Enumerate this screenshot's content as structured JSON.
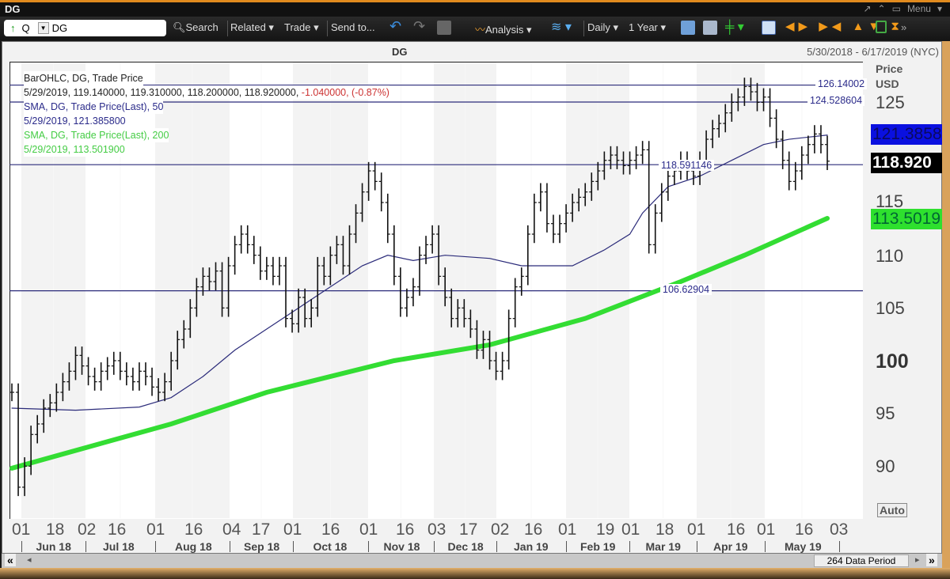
{
  "window": {
    "title": "DG",
    "menu_label": "Menu"
  },
  "toolbar": {
    "ticker_prefix": "Q",
    "ticker": "DG",
    "search": "Search",
    "related": "Related",
    "trade": "Trade",
    "send_to": "Send to...",
    "analysis": "Analysis",
    "period": "Daily",
    "range": "1 Year"
  },
  "chart_data": {
    "type": "bar",
    "title": "DG",
    "date_range": "5/30/2018 - 6/17/2019 (NYC)",
    "ylabel": "Price",
    "ylabel2": "USD",
    "ylim": [
      85.5,
      128
    ],
    "y_ticks": [
      "125",
      "115",
      "110",
      "105",
      "100",
      "95",
      "90"
    ],
    "y_tick_values": [
      125,
      115,
      110,
      105,
      100,
      95,
      90
    ],
    "auto_label": "Auto",
    "legend": {
      "l1": "BarOHLC, DG, Trade Price",
      "l2a": "5/29/2019, 119.140000, 119.310000, 118.200000, 118.920000, ",
      "l2b": "-1.040000, (-0.87%)",
      "l3": "SMA, DG, Trade Price(Last),  50",
      "l4": "5/29/2019, 121.385800",
      "l5": "SMA, DG, Trade Price(Last),  200",
      "l6": "5/29/2019, 113.501900"
    },
    "hlines": [
      {
        "value": 126.14002,
        "label": "126.14002"
      },
      {
        "value": 124.528604,
        "label": "124.528604"
      },
      {
        "value": 118.591146,
        "label": "118.591146"
      },
      {
        "value": 106.62904,
        "label": "106.62904"
      }
    ],
    "tags": {
      "sma50": "121.3858",
      "last": "118.920",
      "sma200": "113.5019"
    },
    "day_ticks": [
      "01",
      "18",
      "02",
      "16",
      "01",
      "16",
      "04",
      "17",
      "01",
      "16",
      "01",
      "16",
      "03",
      "17",
      "02",
      "16",
      "01",
      "19",
      "01",
      "18",
      "01",
      "16",
      "01",
      "16",
      "03"
    ],
    "months": [
      "Jun 18",
      "Jul 18",
      "Aug 18",
      "Sep 18",
      "Oct 18",
      "Nov 18",
      "Dec 18",
      "Jan 19",
      "Feb 19",
      "Mar 19",
      "Apr 19",
      "May 19"
    ],
    "closes": [
      97,
      88,
      90,
      93,
      94,
      95.5,
      96,
      97,
      98,
      99,
      100.5,
      99.5,
      98.5,
      98,
      99,
      99.5,
      100,
      99,
      98.5,
      98,
      99,
      98.5,
      97.5,
      97,
      98,
      100,
      102,
      103,
      105,
      107,
      108,
      107.5,
      108.5,
      105,
      109,
      111,
      112,
      111,
      110,
      108.5,
      109,
      108,
      109,
      104,
      103.5,
      106,
      104,
      105,
      109,
      108,
      110,
      111,
      109,
      112,
      114,
      116,
      118,
      117,
      115,
      112,
      108,
      105,
      106,
      107,
      110,
      111,
      112,
      108,
      106,
      104,
      105,
      104,
      103,
      101,
      102,
      100,
      99,
      100,
      104,
      107,
      108,
      112,
      115,
      116,
      113,
      112,
      113,
      114,
      115,
      115.5,
      116,
      117,
      118,
      119,
      119.5,
      119,
      118.5,
      119,
      119.5,
      120,
      111,
      114,
      116,
      117.5,
      118,
      119,
      118,
      117.5,
      119,
      121,
      122,
      122.5,
      123.5,
      124.5,
      125,
      126,
      125.5,
      124.5,
      125,
      123,
      121,
      119,
      117,
      118,
      119.5,
      120.5,
      121.5,
      120.5,
      118.92
    ],
    "bar_range": 1.4,
    "sma50": [
      [
        0,
        95.5
      ],
      [
        10,
        95.3
      ],
      [
        20,
        95.6
      ],
      [
        25,
        96.5
      ],
      [
        30,
        98.5
      ],
      [
        35,
        101
      ],
      [
        40,
        103
      ],
      [
        45,
        105
      ],
      [
        50,
        107
      ],
      [
        55,
        109
      ],
      [
        59,
        110
      ],
      [
        63,
        109.5
      ],
      [
        68,
        110
      ],
      [
        75,
        109.7
      ],
      [
        80,
        109
      ],
      [
        88,
        109
      ],
      [
        93,
        110.5
      ],
      [
        97,
        112
      ],
      [
        99,
        114
      ],
      [
        103,
        116.5
      ],
      [
        108,
        117.5
      ],
      [
        113,
        119
      ],
      [
        118,
        120.5
      ],
      [
        122,
        121
      ],
      [
        128,
        121.4
      ]
    ],
    "sma200": [
      [
        0,
        89.8
      ],
      [
        25,
        94
      ],
      [
        40,
        97
      ],
      [
        60,
        100
      ],
      [
        75,
        101.5
      ],
      [
        90,
        104
      ],
      [
        105,
        107.5
      ],
      [
        115,
        110
      ],
      [
        128,
        113.5
      ]
    ],
    "colors": {
      "bars": "#111111",
      "sma50": "#2b2b7a",
      "sma200": "#33dd33",
      "hline": "#2b2b7a"
    }
  },
  "footer": {
    "data_period": "264 Data Period"
  }
}
